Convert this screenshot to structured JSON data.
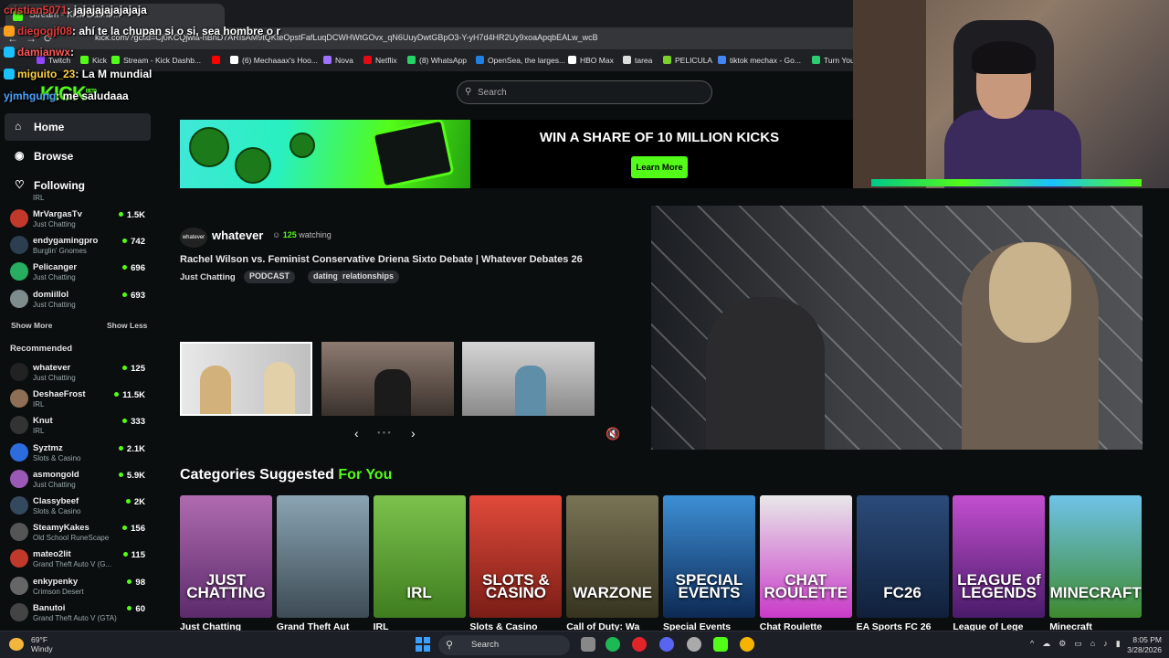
{
  "browser": {
    "tab_title": "Stream - Kick Dashb...",
    "url": "kick.com/?gclid=Cj0KCQjwla-hBhD7ARIsAM9tQKteOpstFafLuqDCWHWtGOvx_qN6UuyDwtGBpO3-Y-yH7d4HR2Uy9xoaApqbEALw_wcB",
    "bookmarks": [
      "Twitch",
      "Kick",
      "Stream - Kick Dashb...",
      "",
      "(6) Mechaaax's Hoo...",
      "Nova",
      "Netflix",
      "(8) WhatsApp",
      "OpenSea, the larges...",
      "HBO Max",
      "tarea",
      "PELICULA",
      "tiktok mechax - Go...",
      "Turn You"
    ]
  },
  "chat_overlay": [
    {
      "user": "cristian5071",
      "message": ": jajajajajajajaja"
    },
    {
      "user": "diegogjf08",
      "message": ": ahí te la chupan si o si, sea hombre o r"
    },
    {
      "user": "damianwx",
      "message": ":"
    },
    {
      "user": "miguito_23",
      "message": ": La M mundial"
    },
    {
      "user": "yjmhgung",
      "message": ": me saludaaa"
    }
  ],
  "header": {
    "logo": "KICK",
    "logo_badge": "BETA",
    "search_placeholder": "Search"
  },
  "sidebar": {
    "nav": [
      {
        "label": "Home",
        "icon": "home-icon"
      },
      {
        "label": "Browse",
        "icon": "compass-icon"
      },
      {
        "label": "Following",
        "icon": "heart-icon"
      }
    ],
    "following_partial_label": "IRL",
    "following": [
      {
        "name": "MrVargasTv",
        "category": "Just Chatting",
        "viewers": "1.5K",
        "color": "#c0392b"
      },
      {
        "name": "endygamingpro",
        "category": "Burglin' Gnomes",
        "viewers": "742",
        "color": "#2c3e50"
      },
      {
        "name": "Pelicanger",
        "category": "Just Chatting",
        "viewers": "696",
        "color": "#27ae60"
      },
      {
        "name": "domiillol",
        "category": "Just Chatting",
        "viewers": "693",
        "color": "#7f8c8d"
      }
    ],
    "show_more": "Show More",
    "show_less": "Show Less",
    "recommended_heading": "Recommended",
    "recommended": [
      {
        "name": "whatever",
        "category": "Just Chatting",
        "viewers": "125",
        "color": "#222222"
      },
      {
        "name": "DeshaeFrost",
        "category": "IRL",
        "viewers": "11.5K",
        "color": "#8e6f55"
      },
      {
        "name": "Knut",
        "category": "IRL",
        "viewers": "333",
        "color": "#333333"
      },
      {
        "name": "Syztmz",
        "category": "Slots & Casino",
        "viewers": "2.1K",
        "color": "#2d6cdf"
      },
      {
        "name": "asmongold",
        "category": "Just Chatting",
        "viewers": "5.9K",
        "color": "#9b59b6"
      },
      {
        "name": "Classybeef",
        "category": "Slots & Casino",
        "viewers": "2K",
        "color": "#34495e"
      },
      {
        "name": "SteamyKakes",
        "category": "Old School RuneScape",
        "viewers": "156",
        "color": "#555555"
      },
      {
        "name": "mateo2lit",
        "category": "Grand Theft Auto V (G...",
        "viewers": "115",
        "color": "#c0392b"
      },
      {
        "name": "enkypenky",
        "category": "Crimson Desert",
        "viewers": "98",
        "color": "#666666"
      },
      {
        "name": "Banutoi",
        "category": "Grand Theft Auto V (GTA)",
        "viewers": "60",
        "color": "#444444"
      }
    ]
  },
  "banner": {
    "title": "WIN A SHARE OF 10 MILLION KICKS",
    "button": "Learn More"
  },
  "featured": {
    "channel": "whatever",
    "avatar_text": "whatever",
    "watching": "125",
    "watching_label": "watching",
    "title": "Rachel Wilson vs. Feminist Conservative Driena Sixto Debate | Whatever Debates 26",
    "category": "Just Chatting",
    "tags": [
      "PODCAST",
      "dating",
      "relationships"
    ],
    "thumbnails": [
      "#cfcfcf",
      "#6f5e55",
      "#b9b9b9"
    ]
  },
  "categories": {
    "title_prefix": "Categories Suggested",
    "title_accent": "For You",
    "items": [
      {
        "name": "Just Chatting",
        "art": "JUST\nCHATTING",
        "c1": "#b06bb0",
        "c2": "#5b2b6b"
      },
      {
        "name": "Grand Theft Aut",
        "art": "",
        "c1": "#8aa4b3",
        "c2": "#3d4b55"
      },
      {
        "name": "IRL",
        "art": "IRL",
        "c1": "#7cc24d",
        "c2": "#3f7d1f"
      },
      {
        "name": "Slots & Casino",
        "art": "SLOTS &\nCASINO",
        "c1": "#e14a3a",
        "c2": "#7a1d16"
      },
      {
        "name": "Call of Duty: Wa",
        "art": "WARZONE",
        "c1": "#7a7456",
        "c2": "#36331f"
      },
      {
        "name": "Special Events",
        "art": "SPECIAL\nEVENTS",
        "c1": "#3d8fd6",
        "c2": "#0d2a55"
      },
      {
        "name": "Chat Roulette",
        "art": "CHAT\nROULETTE",
        "c1": "#e8e8e8",
        "c2": "#c93ac9"
      },
      {
        "name": "EA Sports FC 26",
        "art": "FC26",
        "c1": "#2b4b7a",
        "c2": "#10203a"
      },
      {
        "name": "League of Lege",
        "art": "LEAGUE of\nLEGENDS",
        "c1": "#c34fd0",
        "c2": "#4a1b6a"
      },
      {
        "name": "Minecraft",
        "art": "MINECRAFT",
        "c1": "#6fc3e8",
        "c2": "#3d8a2f"
      }
    ]
  },
  "taskbar": {
    "temperature": "69°F",
    "weather": "Windy",
    "search": "Search",
    "time": "8:05 PM",
    "date": "3/28/2026"
  },
  "colors": {
    "accent": "#53fc18",
    "background": "#0b0e0f"
  }
}
